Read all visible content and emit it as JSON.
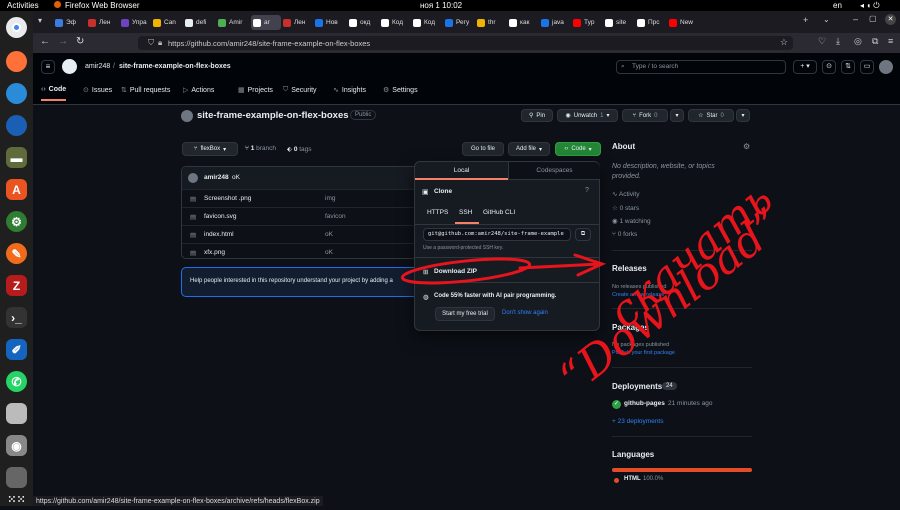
{
  "system": {
    "activities": "Activities",
    "app_name": "Firefox Web Browser",
    "clock": "ноя 1  10:02",
    "lang": "en"
  },
  "tabs": [
    {
      "label": "Эф",
      "color": "#3b7ddd"
    },
    {
      "label": "Лен",
      "color": "#c9302c"
    },
    {
      "label": "Упра",
      "color": "#6f42c1"
    },
    {
      "label": "Can",
      "color": "#f0b400"
    },
    {
      "label": "defi",
      "color": "#e6edf3"
    },
    {
      "label": "Amir",
      "color": "#4caf50"
    },
    {
      "label": "ar",
      "color": "#ffffff"
    },
    {
      "label": "Лен",
      "color": "#c9302c"
    },
    {
      "label": "Нов",
      "color": "#1a73e8"
    },
    {
      "label": "окд",
      "color": "#ffffff"
    },
    {
      "label": "Код",
      "color": "#ffffff"
    },
    {
      "label": "Код",
      "color": "#ffffff"
    },
    {
      "label": "Регу",
      "color": "#1a73e8"
    },
    {
      "label": "thr",
      "color": "#f0b400"
    },
    {
      "label": "как",
      "color": "#ffffff"
    },
    {
      "label": "java",
      "color": "#1a73e8"
    },
    {
      "label": "Typ",
      "color": "#ff0000"
    },
    {
      "label": "site",
      "color": "#ffffff"
    },
    {
      "label": "Прс",
      "color": "#ffffff"
    },
    {
      "label": "New",
      "color": "#ff0000"
    }
  ],
  "url": "https://github.com/amir248/site-frame-example-on-flex-boxes",
  "header": {
    "owner": "amir248",
    "repo": "site-frame-example-on-flex-boxes",
    "search_placeholder": "Type / to search"
  },
  "repo_nav": [
    "Code",
    "Issues",
    "Pull requests",
    "Actions",
    "Projects",
    "Security",
    "Insights",
    "Settings"
  ],
  "repo": {
    "name": "site-frame-example-on-flex-boxes",
    "visibility": "Public",
    "pin": "Pin",
    "unwatch": "Unwatch",
    "unwatch_count": "1",
    "fork": "Fork",
    "fork_count": "0",
    "star": "Star",
    "star_count": "0"
  },
  "branch": {
    "name": "flexBox",
    "branches": "1",
    "branches_label": "branch",
    "tags": "0",
    "tags_label": "tags"
  },
  "buttons": {
    "goto": "Go to file",
    "add": "Add file",
    "code": "Code"
  },
  "commit": {
    "author": "amir248",
    "message": "oK"
  },
  "files": [
    {
      "name": "Screenshot .png",
      "msg": "img"
    },
    {
      "name": "favicon.svg",
      "msg": "favicon"
    },
    {
      "name": "index.html",
      "msg": "oK"
    },
    {
      "name": "xfx.png",
      "msg": "oK"
    }
  ],
  "readme_prompt": "Help people interested in this repository understand your project by adding a",
  "dropdown": {
    "tab_local": "Local",
    "tab_codespaces": "Codespaces",
    "clone": "Clone",
    "protocols": [
      "HTTPS",
      "SSH",
      "GitHub CLI"
    ],
    "ssh_url": "git@github.com:amir248/site-frame-example",
    "ssh_hint": "Use a password-protected SSH key.",
    "download": "Download ZIP",
    "copilot": "Code 55% faster with AI pair programming.",
    "trial": "Start my free trial",
    "dismiss": "Don't show again"
  },
  "about": {
    "title": "About",
    "description": "No description, website, or topics provided.",
    "stats": [
      "Activity",
      "0 stars",
      "1 watching",
      "0 forks"
    ]
  },
  "releases": {
    "title": "Releases",
    "none": "No releases published",
    "create": "Create a new release"
  },
  "packages": {
    "title": "Packages",
    "none": "No packages published",
    "publish": "Publish your first package"
  },
  "deployments": {
    "title": "Deployments",
    "count": "24",
    "env": "github-pages",
    "time": "21 minutes ago",
    "more": "+ 23 deployments"
  },
  "languages": {
    "title": "Languages",
    "name": "HTML",
    "pct": "100.0%",
    "fill": 1.0,
    "color": "#e34c26"
  },
  "annotation": {
    "line1": "скачать",
    "line2": "“Download”"
  },
  "status_url": "https://github.com/amir248/site-frame-example-on-flex-boxes/archive/refs/heads/flexBox.zip"
}
